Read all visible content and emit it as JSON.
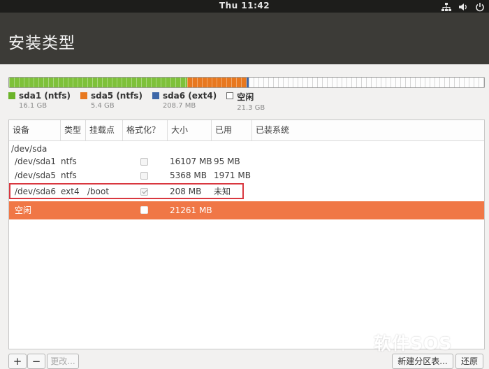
{
  "topbar": {
    "clock": "Thu 11:42"
  },
  "header": {
    "title": "安装类型"
  },
  "partition_bar": {
    "segments": [
      {
        "name": "sda1",
        "value_mb": 16107,
        "color": "#7ec13a",
        "style": "striped"
      },
      {
        "name": "sda5",
        "value_mb": 5368,
        "color": "#e8781f",
        "style": "striped"
      },
      {
        "name": "sda6",
        "value_mb": 208,
        "color": "#3d67a8",
        "style": "solid"
      },
      {
        "name": "free",
        "value_mb": 21261,
        "color": "#fdfdfd",
        "style": "free"
      }
    ]
  },
  "legend": [
    {
      "name": "sda1 (ntfs)",
      "size": "16.1 GB",
      "color": "#6bb42a"
    },
    {
      "name": "sda5 (ntfs)",
      "size": "5.4 GB",
      "color": "#e8781f"
    },
    {
      "name": "sda6 (ext4)",
      "size": "208.7 MB",
      "color": "#3d67a8"
    },
    {
      "name": "空闲",
      "size": "21.3 GB",
      "color": "#ffffff"
    }
  ],
  "table": {
    "columns": [
      "设备",
      "类型",
      "挂载点",
      "格式化？",
      "大小",
      "已用",
      "已装系统"
    ],
    "disk": "/dev/sda",
    "rows": [
      {
        "device": "/dev/sda1",
        "type": "ntfs",
        "mount": "",
        "format": false,
        "size": "16107 MB",
        "used": "95 MB"
      },
      {
        "device": "/dev/sda5",
        "type": "ntfs",
        "mount": "",
        "format": false,
        "size": "5368 MB",
        "used": "1971 MB"
      },
      {
        "device": "/dev/sda6",
        "type": "ext4",
        "mount": "/boot",
        "format": true,
        "size": "208 MB",
        "used": "未知"
      },
      {
        "device": "空闲",
        "type": "",
        "mount": "",
        "format": false,
        "size": "21261 MB",
        "used": ""
      }
    ]
  },
  "buttons": {
    "add": "+",
    "remove": "−",
    "change": "更改...",
    "new_table": "新建分区表...",
    "revert": "还原"
  },
  "watermark": {
    "text": "软件SOS"
  },
  "colors": {
    "selected_row": "#f07746",
    "highlight_box": "#d9373f",
    "header_bg": "#3c3b37"
  }
}
